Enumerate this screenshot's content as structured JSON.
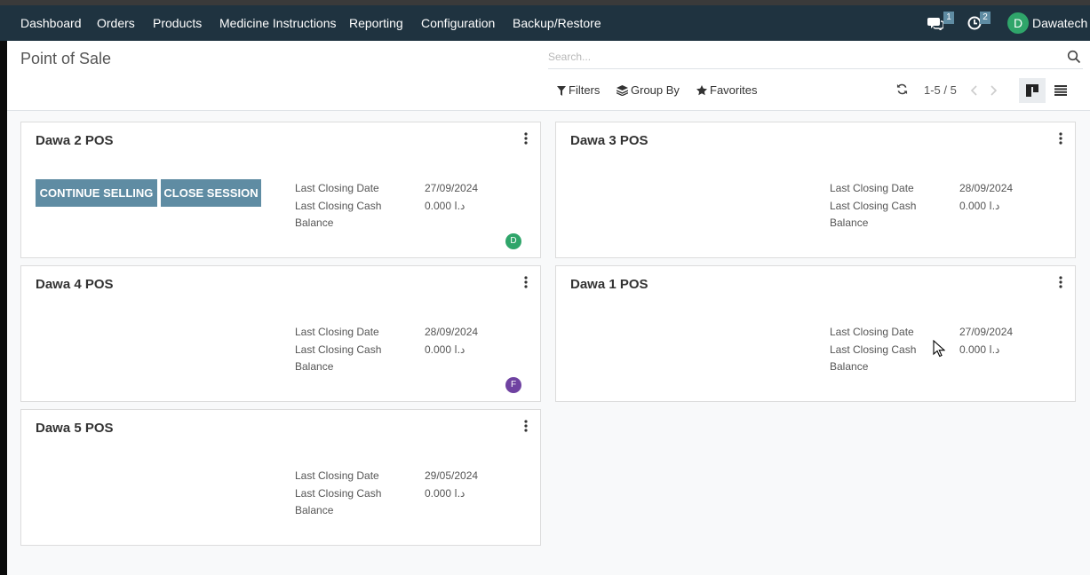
{
  "navbar": {
    "menu": [
      "Dashboard",
      "Orders",
      "Products",
      "Medicine Instructions",
      "Reporting",
      "Configuration",
      "Backup/Restore"
    ],
    "messages_count": "1",
    "activities_count": "2",
    "user_initial": "D",
    "user_name": "Dawatech"
  },
  "control_panel": {
    "title": "Point of Sale",
    "search_placeholder": "Search...",
    "filters_label": "Filters",
    "group_by_label": "Group By",
    "favorites_label": "Favorites",
    "pager": "1-5 / 5"
  },
  "labels": {
    "last_closing_date": "Last Closing Date",
    "last_closing_cash": "Last Closing Cash",
    "balance": "Balance"
  },
  "cards": [
    {
      "name": "Dawa 2 POS",
      "date": "27/09/2024",
      "cash": "0.000 د.ا",
      "continue_label": "CONTINUE SELLING",
      "close_label": "CLOSE SESSION",
      "avatar": "D"
    },
    {
      "name": "Dawa 3 POS",
      "date": "28/09/2024",
      "cash": "0.000 د.ا"
    },
    {
      "name": "Dawa 4 POS",
      "date": "28/09/2024",
      "cash": "0.000 د.ا",
      "avatar": "F"
    },
    {
      "name": "Dawa 1 POS",
      "date": "27/09/2024",
      "cash": "0.000 د.ا"
    },
    {
      "name": "Dawa 5 POS",
      "date": "29/05/2024",
      "cash": "0.000 د.ا"
    }
  ],
  "colors": {
    "navbar": "#1f3340",
    "primary_button": "#5f8ca3",
    "avatar_d": "#2fa56a",
    "avatar_f": "#6f42a1"
  }
}
